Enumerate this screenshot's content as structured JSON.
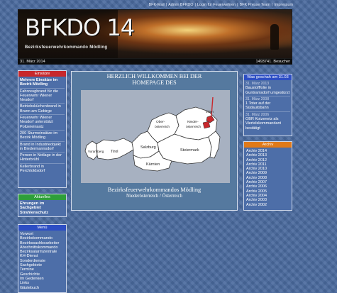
{
  "topnav": {
    "links": [
      "BFK-Mail",
      "Admin BFKDO",
      "Login für Feuerwehren",
      "BFK Presse Team",
      "Impressum"
    ],
    "separator": "|"
  },
  "banner": {
    "title": "BFKDO 14",
    "subtitle": "Bezirksfeuerwehrkommando Mödling"
  },
  "infobar": {
    "date": "31. März 2014",
    "visitors": "1493741. Besucher"
  },
  "einsaetze": {
    "header": "Einsätze",
    "items": [
      "Mehrere Einsätze im Bezirk Mödling",
      "Fahrzeugbrand für die Feuerwehr Wiener Neudorf",
      "Betriebsküchenbrand in Brunn am Gebirge",
      "Feuerwehr Wiener Neudorf unterstützt Polizeieinsatz",
      "200 Sturmeinsätze im Bezirk Mödling",
      "Brand in Industrieobjekt in Biedermannsdorf",
      "Person in Notlage in der Hinterbrühl",
      "Kellerbrand in Perchtoldsdorf"
    ]
  },
  "aktuelles": {
    "header": "Aktuelles",
    "text": "Ehrungen im Sachgebiet Strahlenschutz"
  },
  "menu": {
    "header": "Menü",
    "items": [
      "Vorwort",
      "Bezirkskommando",
      "Bezirkssachbearbeiter",
      "Abschnittskommando",
      "Bezirksalarmzentrale",
      "KH-Dienst",
      "Sonderdienste",
      "Sachgebiete",
      "Termine",
      "Geschichte",
      "Im Gedenken",
      "Links",
      "Gästebuch"
    ]
  },
  "center": {
    "welcome_line1": "Herzlich Willkommen bei der",
    "welcome_line2": "Homepage des",
    "bottom_line1": "Bezirksfeuerwehrkommandos Mödling",
    "bottom_line2": "Niederösterreich / Österreich",
    "map_labels": {
      "vorarlberg": "Vorarl-berg",
      "tirol": "Tirol",
      "salzburg": "Salzburg",
      "kaernten": "Kärnten",
      "steiermark": "Steiermark",
      "ooe_line1": "Ober-",
      "ooe_line2": "österreich",
      "noe_line1": "Nieder-",
      "noe_line2": "österreich",
      "wien": "Wien"
    }
  },
  "was_geschah": {
    "header": "Was geschah am 31.03",
    "entries": [
      {
        "date": "31. März 2013",
        "text": "Baustofffolie in Guntramsdorf umgestürzt"
      },
      {
        "date": "31. März 2008",
        "text": "1 Toter auf der Südautobahn"
      },
      {
        "date": "31. März 2006",
        "text": "OBR Kotzenetz als Viertelskommandant bestätigt"
      }
    ]
  },
  "archiv": {
    "header": "Archiv",
    "items": [
      "Archiv 2014",
      "Archiv 2013",
      "Archiv 2012",
      "Archiv 2011",
      "Archiv 2010",
      "Archiv 2009",
      "Archiv 2008",
      "Archiv 2007",
      "Archiv 2006",
      "Archiv 2005",
      "Archiv 2004",
      "Archiv 2003",
      "Archiv 2002"
    ]
  },
  "colors": {
    "background": "#4a6a9e",
    "einsaetze_header": "#c8282c",
    "aktuelles_header": "#2e9e3a",
    "menu_header": "#2d4ec4",
    "was_geschah_header": "#2d4ec4",
    "archiv_header": "#e07a1a",
    "map_highlight": "#c8282c"
  }
}
